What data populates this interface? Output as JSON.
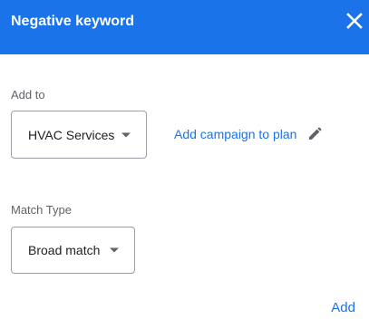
{
  "dialog": {
    "title": "Negative keyword",
    "close_icon": "close-icon"
  },
  "add_to": {
    "label": "Add to",
    "selected": "HVAC Services",
    "link_text": "Add campaign to plan",
    "link_icon": "pencil-icon"
  },
  "match_type": {
    "label": "Match Type",
    "selected": "Broad match"
  },
  "actions": {
    "add_label": "Add"
  },
  "colors": {
    "header_bg": "#1a73e8",
    "link": "#1a73e8",
    "border": "#9aa0a6",
    "label": "#5f6368"
  }
}
